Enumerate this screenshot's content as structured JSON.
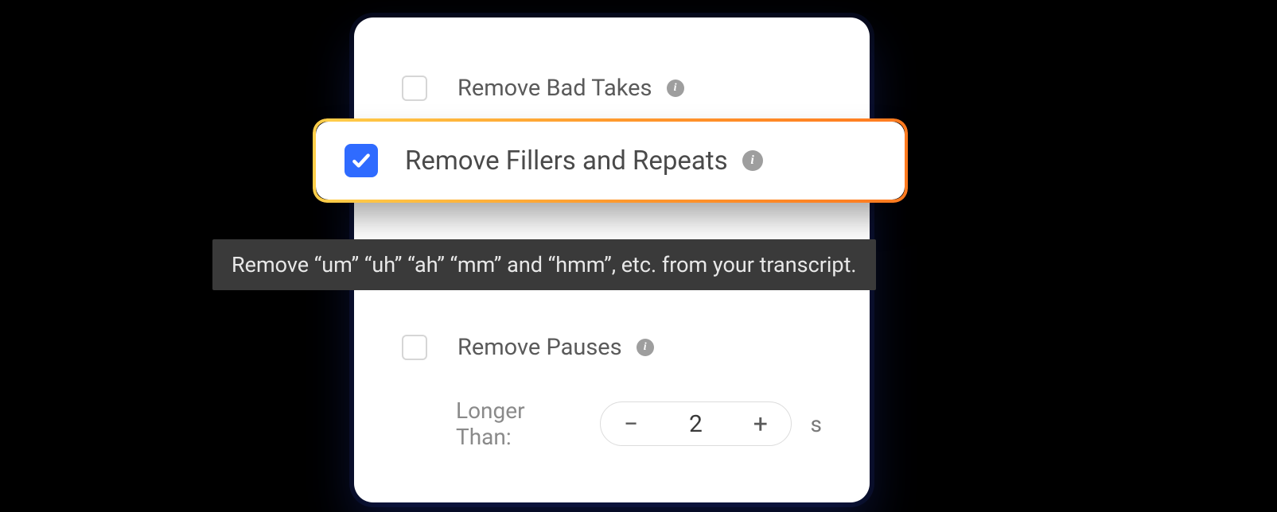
{
  "options": {
    "bad_takes": {
      "label": "Remove Bad Takes",
      "checked": false
    },
    "fillers": {
      "label": "Remove Fillers and Repeats",
      "checked": true
    },
    "pauses": {
      "label": "Remove Pauses",
      "checked": false
    }
  },
  "pause_setting": {
    "label": "Longer Than:",
    "value": "2",
    "unit": "s",
    "minus": "−",
    "plus": "+"
  },
  "tooltip": "Remove “um” “uh” “ah” “mm” and “hmm”, etc. from your transcript."
}
